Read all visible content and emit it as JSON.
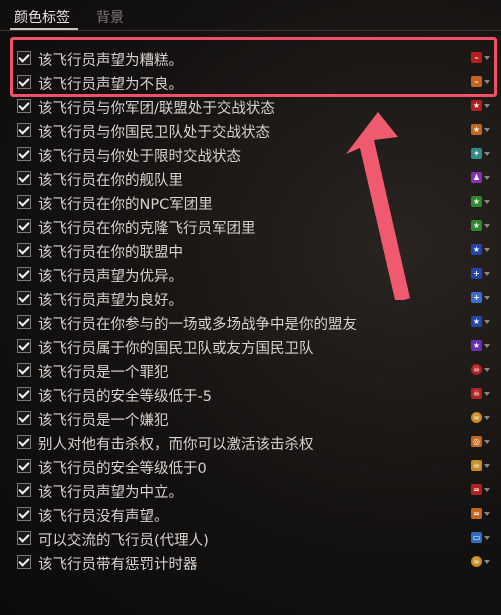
{
  "tabs": {
    "active": "颜色标签",
    "inactive": "背景"
  },
  "items": [
    {
      "label": "该飞行员声望为糟糕。",
      "icon": "minus-icon",
      "glyph": "–",
      "color": "#b3201c"
    },
    {
      "label": "该飞行员声望为不良。",
      "icon": "minus-icon",
      "glyph": "–",
      "color": "#c5661f"
    },
    {
      "label": "该飞行员与你军团/联盟处于交战状态",
      "icon": "star-icon",
      "glyph": "★",
      "color": "#b3201c"
    },
    {
      "label": "该飞行员与你国民卫队处于交战状态",
      "icon": "star-icon",
      "glyph": "★",
      "color": "#c5661f"
    },
    {
      "label": "该飞行员与你处于限时交战状态",
      "icon": "crossed-swords-icon",
      "glyph": "✦",
      "color": "#2f8a8a"
    },
    {
      "label": "该飞行员在你的舰队里",
      "icon": "person-icon",
      "glyph": "♟",
      "color": "#8a2fb0"
    },
    {
      "label": "该飞行员在你的NPC军团里",
      "icon": "star-icon",
      "glyph": "★",
      "color": "#2f8a2f"
    },
    {
      "label": "该飞行员在你的克隆飞行员军团里",
      "icon": "star-icon",
      "glyph": "★",
      "color": "#2f8a2f"
    },
    {
      "label": "该飞行员在你的联盟中",
      "icon": "star-icon",
      "glyph": "★",
      "color": "#2445a8"
    },
    {
      "label": "该飞行员声望为优异。",
      "icon": "plus-icon",
      "glyph": "+",
      "color": "#2445a8"
    },
    {
      "label": "该飞行员声望为良好。",
      "icon": "plus-icon",
      "glyph": "+",
      "color": "#3a6fd0"
    },
    {
      "label": "该飞行员在你参与的一场或多场战争中是你的盟友",
      "icon": "star-icon",
      "glyph": "★",
      "color": "#2445a8"
    },
    {
      "label": "该飞行员属于你的国民卫队或友方国民卫队",
      "icon": "star-icon",
      "glyph": "★",
      "color": "#6a2fb0"
    },
    {
      "label": "该飞行员是一个罪犯",
      "icon": "skull-icon",
      "glyph": "☠",
      "color": "#b3201c",
      "round": true
    },
    {
      "label": "该飞行员的安全等级低于-5",
      "icon": "skull-icon",
      "glyph": "☠",
      "color": "#b3201c"
    },
    {
      "label": "该飞行员是一个嫌犯",
      "icon": "skull-icon",
      "glyph": "☠",
      "color": "#c98a1f",
      "round": true
    },
    {
      "label": "别人对他有击杀权，而你可以激活该击杀权",
      "icon": "target-icon",
      "glyph": "◎",
      "color": "#c5661f"
    },
    {
      "label": "该飞行员的安全等级低于0",
      "icon": "skull-icon",
      "glyph": "☠",
      "color": "#c98a1f"
    },
    {
      "label": "该飞行员声望为中立。",
      "icon": "equals-icon",
      "glyph": "=",
      "color": "#b3201c"
    },
    {
      "label": "该飞行员没有声望。",
      "icon": "equals-icon",
      "glyph": "=",
      "color": "#c5661f"
    },
    {
      "label": "可以交流的飞行员(代理人)",
      "icon": "chat-icon",
      "glyph": "▭",
      "color": "#2f6fc0"
    },
    {
      "label": "该飞行员带有惩罚计时器",
      "icon": "skull-icon",
      "glyph": "☠",
      "color": "#c98a1f",
      "round": true
    }
  ]
}
